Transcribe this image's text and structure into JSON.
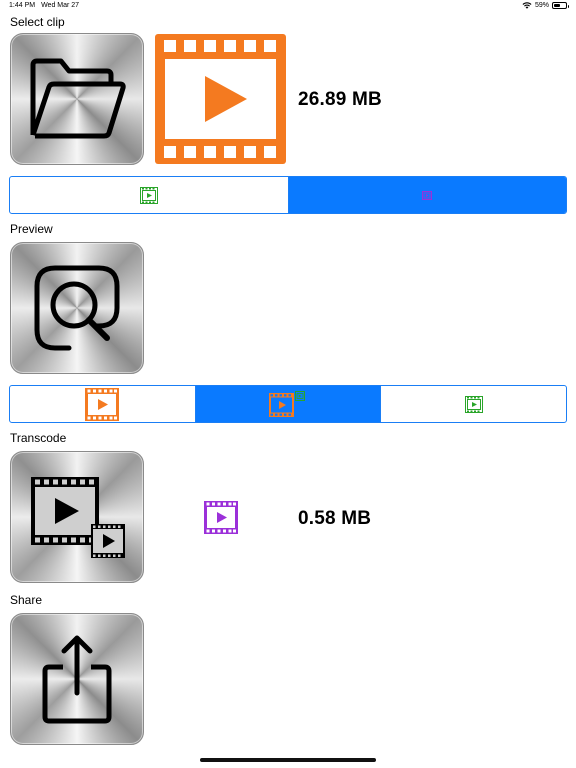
{
  "status_bar": {
    "time": "1:44 PM",
    "date": "Wed Mar 27",
    "battery_percent_text": "59%",
    "battery_level": 0.59
  },
  "sections": {
    "select_clip": {
      "label": "Select clip",
      "button_icon": "folder-icon",
      "thumbnail_icon": "film-play-icon",
      "size": "26.89 MB"
    },
    "preview": {
      "label": "Preview",
      "button_icon": "magnify-icon"
    },
    "transcode": {
      "label": "Transcode",
      "button_icon": "transcode-film-icon",
      "thumbnail_icon": "film-play-icon",
      "size": "0.58 MB"
    },
    "share": {
      "label": "Share",
      "button_icon": "share-icon"
    }
  },
  "segmented_select": {
    "segments": [
      {
        "icon": "film-play-icon",
        "color": "#2aa52a",
        "selected": false
      },
      {
        "icon": "film-small-icon",
        "color": "#9b30d9",
        "selected": true
      }
    ]
  },
  "segmented_preview": {
    "segments": [
      {
        "icon": "film-play-icon",
        "color": "#f47a20",
        "selected": false
      },
      {
        "icon": "film-compare-icon",
        "color": "#f47a20",
        "selected": true
      },
      {
        "icon": "film-play-icon",
        "color": "#2aa52a",
        "selected": false
      }
    ]
  },
  "colors": {
    "accent_blue": "#0a7aff",
    "orange": "#f47a20",
    "green": "#2aa52a",
    "purple": "#9b30d9"
  }
}
